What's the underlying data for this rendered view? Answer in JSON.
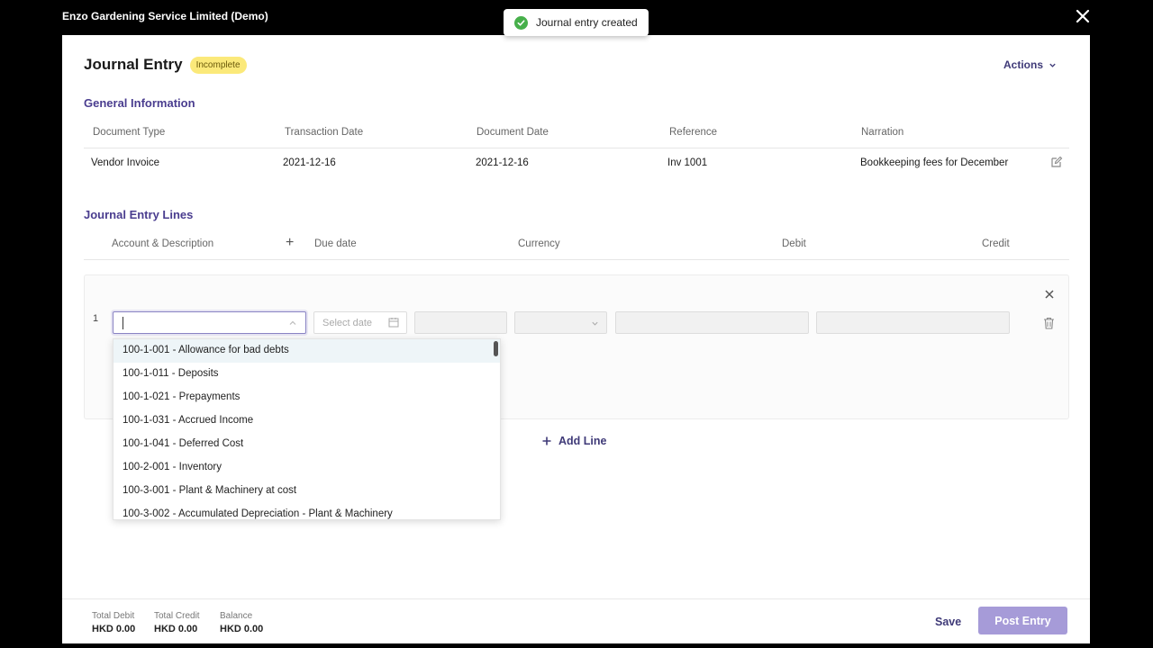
{
  "app": {
    "company": "Enzo Gardening Service Limited (Demo)"
  },
  "toast": {
    "message": "Journal entry created",
    "color": "#47b04b"
  },
  "header": {
    "title": "Journal Entry",
    "status": "Incomplete",
    "actions_label": "Actions"
  },
  "general_info": {
    "title": "General Information",
    "columns": [
      "Document Type",
      "Transaction Date",
      "Document Date",
      "Reference",
      "Narration"
    ],
    "values": [
      "Vendor Invoice",
      "2021-12-16",
      "2021-12-16",
      "Inv 1001",
      "Bookkeeping fees for December"
    ]
  },
  "lines": {
    "title": "Journal Entry Lines",
    "columns": [
      "Account & Description",
      "Due date",
      "Currency",
      "Debit",
      "Credit"
    ],
    "row_number": "1",
    "account_value": "",
    "date_placeholder": "Select date",
    "add_line_label": "Add Line"
  },
  "account_dropdown": {
    "options": [
      "100-1-001 - Allowance for bad debts",
      "100-1-011 - Deposits",
      "100-1-021 - Prepayments",
      "100-1-031 - Accrued Income",
      "100-1-041 - Deferred Cost",
      "100-2-001 - Inventory",
      "100-3-001 - Plant & Machinery at cost",
      "100-3-002 - Accumulated Depreciation - Plant & Machinery"
    ]
  },
  "footer": {
    "total_debit_label": "Total Debit",
    "total_debit": "HKD 0.00",
    "total_credit_label": "Total Credit",
    "total_credit": "HKD 0.00",
    "balance_label": "Balance",
    "balance": "HKD 0.00",
    "save_label": "Save",
    "post_label": "Post Entry"
  },
  "colors": {
    "accent": "#4a3d8f",
    "badge": "#fbe97a",
    "post_button": "#a69bd8"
  }
}
